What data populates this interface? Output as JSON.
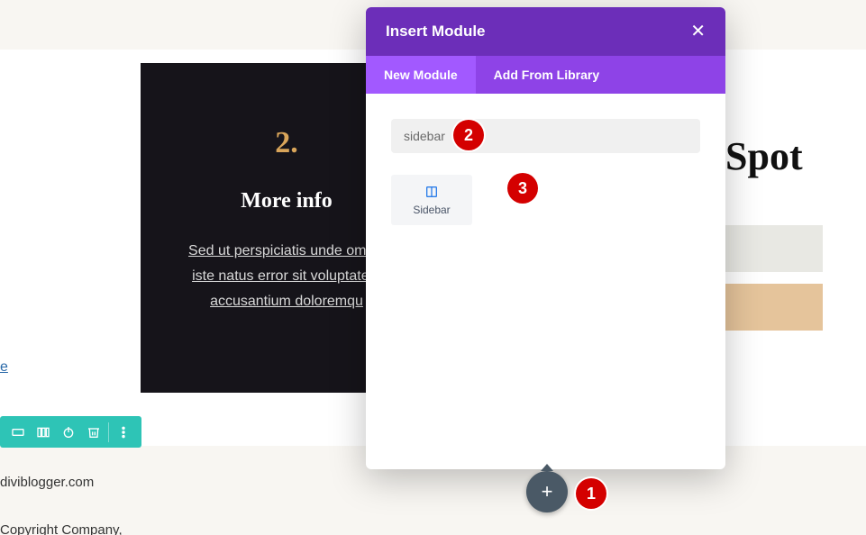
{
  "background": {
    "dark_card": {
      "number": "2.",
      "title": "More info",
      "body": "Sed ut perspiciatis unde omnis iste natus error sit voluptatem accusantium doloremqu"
    },
    "spot_fragment": "Spot",
    "partial_link": "e",
    "footer_line1": "diviblogger.com",
    "footer_line2": "Copyright Company,"
  },
  "toolbar_icons": [
    "row-icon",
    "columns-icon",
    "power-icon",
    "trash-icon",
    "more-icon"
  ],
  "modal": {
    "title": "Insert Module",
    "tabs": {
      "new": "New Module",
      "library": "Add From Library"
    },
    "search_value": "sidebar",
    "module": {
      "label": "Sidebar"
    }
  },
  "add_button_glyph": "+",
  "annotations": {
    "a1": "1",
    "a2": "2",
    "a3": "3"
  }
}
